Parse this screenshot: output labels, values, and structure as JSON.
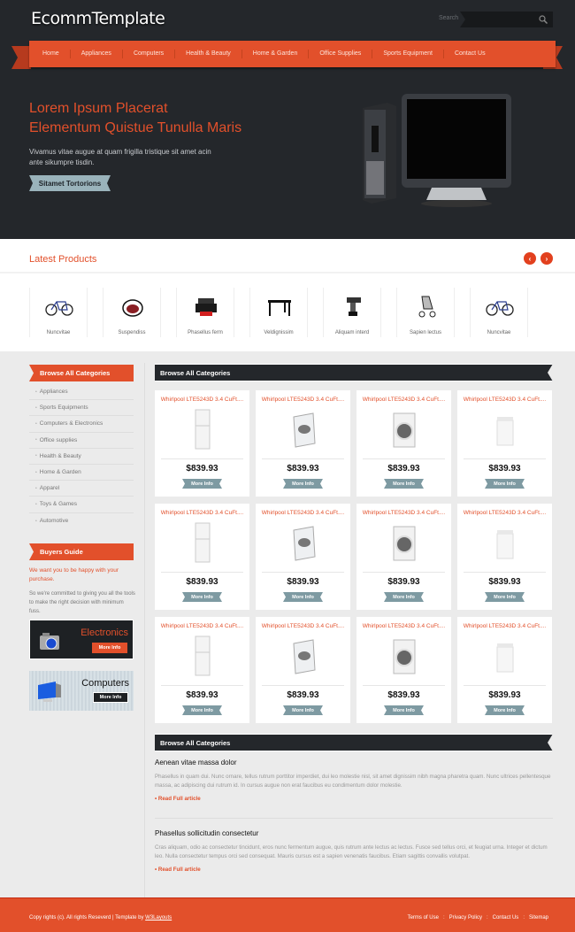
{
  "header": {
    "logo": "EcommTemplate",
    "search_label": "Search",
    "search_placeholder": ""
  },
  "nav": [
    "Home",
    "Appliances",
    "Computers",
    "Health & Beauty",
    "Home & Garden",
    "Office Supplies",
    "Sports Equipment",
    "Contact Us"
  ],
  "hero": {
    "title_line1": "Lorem Ipsum Placerat",
    "title_line2": "Elementum Quistue Tunulla Maris",
    "text": "Vivamus vitae augue at quam frigilla tristique sit amet acin ante sikumpre tisdin.",
    "button": "Sitamet Tortorions",
    "image": "desktop-computer-monitor"
  },
  "latest": {
    "title": "Latest Products",
    "items": [
      {
        "label": "Nuncvitae",
        "icon": "bicycle"
      },
      {
        "label": "Suspendiss",
        "icon": "toy-car"
      },
      {
        "label": "Phasellus ferm",
        "icon": "printer"
      },
      {
        "label": "Veldignissim",
        "icon": "table"
      },
      {
        "label": "Aliquam interd",
        "icon": "drill"
      },
      {
        "label": "Sapien lectus",
        "icon": "stroller"
      },
      {
        "label": "Nuncvitae",
        "icon": "bicycle"
      }
    ]
  },
  "sidebar": {
    "categories_title": "Browse All Categories",
    "categories": [
      "Appliances",
      "Sports Equipments",
      "Computers & Electronics",
      "Office supplies",
      "Health & Beauty",
      "Home & Garden",
      "Apparel",
      "Toys & Games",
      "Automotive"
    ],
    "guide_title": "Buyers Guide",
    "guide_highlight": "We want you to be happy with your purchase.",
    "guide_text": "So we're committed to giving you all the tools to make the right decision with minimum fuss.",
    "promos": [
      {
        "title": "Electronics",
        "button": "More Info"
      },
      {
        "title": "Computers",
        "button": "More Info"
      }
    ]
  },
  "products": {
    "title": "Browse All Categories",
    "items": [
      {
        "name": "Whirlpool LTE5243D 3.4 CuFt....",
        "price": "$839.93",
        "button": "More Info",
        "img": "stacked-washer"
      },
      {
        "name": "Whirlpool LTE5243D 3.4 CuFt....",
        "price": "$839.93",
        "button": "More Info",
        "img": "top-load-washer"
      },
      {
        "name": "Whirlpool LTE5243D 3.4 CuFt....",
        "price": "$839.93",
        "button": "More Info",
        "img": "front-load-washer"
      },
      {
        "name": "Whirlpool LTE5243D 3.4 CuFt....",
        "price": "$839.93",
        "button": "More Info",
        "img": "white-washer"
      },
      {
        "name": "Whirlpool LTE5243D 3.4 CuFt....",
        "price": "$839.93",
        "button": "More Info",
        "img": "stacked-washer"
      },
      {
        "name": "Whirlpool LTE5243D 3.4 CuFt....",
        "price": "$839.93",
        "button": "More Info",
        "img": "top-load-washer"
      },
      {
        "name": "Whirlpool LTE5243D 3.4 CuFt....",
        "price": "$839.93",
        "button": "More Info",
        "img": "front-load-washer"
      },
      {
        "name": "Whirlpool LTE5243D 3.4 CuFt....",
        "price": "$839.93",
        "button": "More Info",
        "img": "white-washer"
      },
      {
        "name": "Whirlpool LTE5243D 3.4 CuFt....",
        "price": "$839.93",
        "button": "More Info",
        "img": "stacked-washer"
      },
      {
        "name": "Whirlpool LTE5243D 3.4 CuFt....",
        "price": "$839.93",
        "button": "More Info",
        "img": "top-load-washer"
      },
      {
        "name": "Whirlpool LTE5243D 3.4 CuFt....",
        "price": "$839.93",
        "button": "More Info",
        "img": "front-load-washer"
      },
      {
        "name": "Whirlpool LTE5243D 3.4 CuFt....",
        "price": "$839.93",
        "button": "More Info",
        "img": "white-washer"
      }
    ]
  },
  "articles": {
    "title": "Browse All Categories",
    "items": [
      {
        "title": "Aenean vitae massa dolor",
        "text": "Phasellus in quam dui. Nunc ornare, tellus rutrum porttitor imperdiet, dui leo molestie nisl, sit amet dignissim nibh magna pharetra quam. Nunc ultrices pellentesque massa, ac adipiscing dui rutrum id. In cursus augue non erat faucibus eu condimentum dolor molestie.",
        "link": "• Read Full article"
      },
      {
        "title": "Phasellus sollicitudin consectetur",
        "text": "Cras aliquam, odio ac consectetur tincidunt, eros nunc fermentum augue, quis rutrum ante lectus ac lectus. Fusce sed tellus orci, et feugiat urna. Integer et dictum leo. Nulla consectetur tempus orci sed consequat. Mauris cursus est a sapien venenatis faucibus. Etiam sagittis convallis volutpat.",
        "link": "• Read Full article"
      }
    ]
  },
  "footer": {
    "copyright": "Copy rights (c). All rights Reseverd | Template by ",
    "credit": "W3Layouts",
    "links": [
      "Terms of Use",
      "Privacy Policy",
      "Contact Us",
      "Sitemap"
    ]
  },
  "colors": {
    "accent": "#e2502b",
    "dark": "#24272b",
    "button_gray": "#7e9aa2"
  }
}
